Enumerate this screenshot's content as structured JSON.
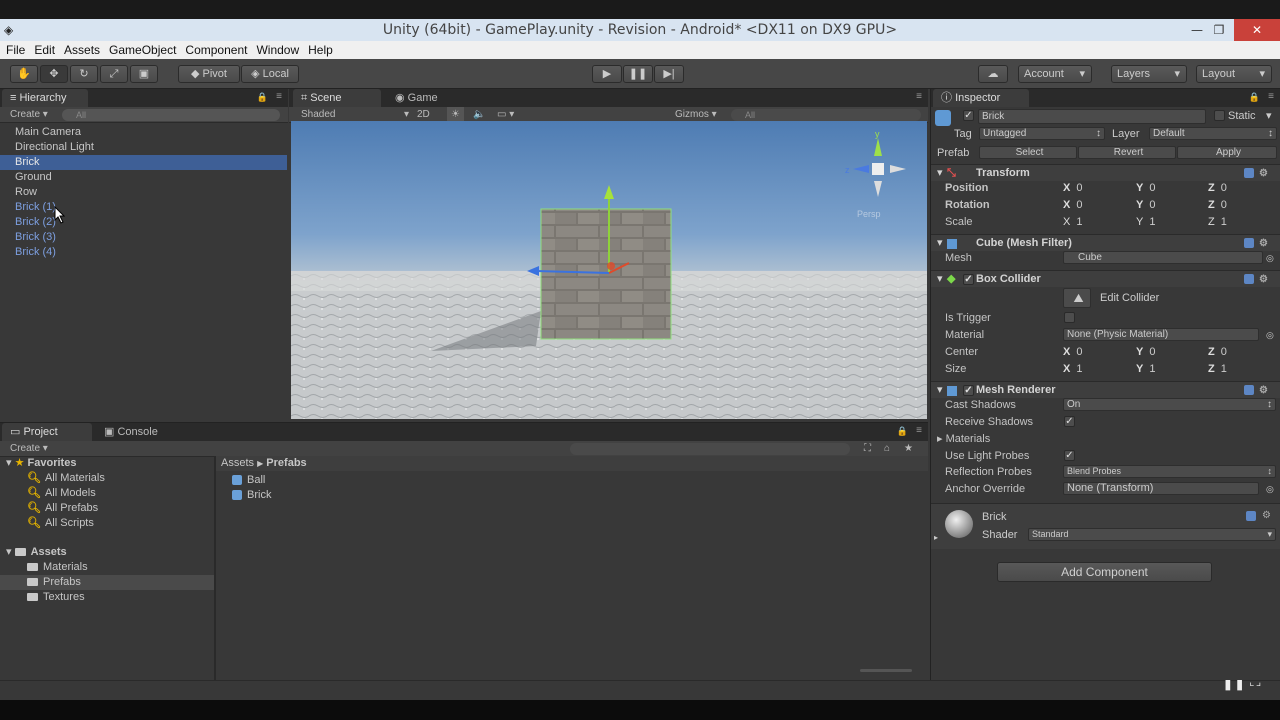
{
  "window": {
    "title": "Unity (64bit) - GamePlay.unity - Revision - Android* <DX11 on DX9 GPU>"
  },
  "menu": [
    "File",
    "Edit",
    "Assets",
    "GameObject",
    "Component",
    "Window",
    "Help"
  ],
  "toolbar": {
    "pivot": "Pivot",
    "local": "Local",
    "account": "Account",
    "layers": "Layers",
    "layout": "Layout"
  },
  "hierarchy": {
    "tab": "Hierarchy",
    "create": "Create",
    "search_placeholder": "All",
    "items": [
      "Main Camera",
      "Directional Light",
      "Brick",
      "Ground",
      "Row",
      "Brick (1)",
      "Brick (2)",
      "Brick (3)",
      "Brick (4)"
    ]
  },
  "scene": {
    "tab_scene": "Scene",
    "tab_game": "Game",
    "shaded": "Shaded",
    "mode_2d": "2D",
    "gizmos": "Gizmos",
    "search_placeholder": "All",
    "persp": "Persp"
  },
  "project": {
    "tab_project": "Project",
    "tab_console": "Console",
    "create": "Create",
    "favorites_label": "Favorites",
    "favorites": [
      "All Materials",
      "All Models",
      "All Prefabs",
      "All Scripts"
    ],
    "assets_label": "Assets",
    "folders": [
      "Materials",
      "Prefabs",
      "Textures"
    ],
    "breadcrumb_root": "Assets",
    "breadcrumb_current": "Prefabs",
    "files": [
      "Ball",
      "Brick"
    ]
  },
  "inspector": {
    "tab": "Inspector",
    "object_name": "Brick",
    "static": "Static",
    "tag_label": "Tag",
    "tag_value": "Untagged",
    "layer_label": "Layer",
    "layer_value": "Default",
    "prefab_label": "Prefab",
    "prefab_select": "Select",
    "prefab_revert": "Revert",
    "prefab_apply": "Apply",
    "transform": {
      "title": "Transform",
      "position_label": "Position",
      "position": [
        "0",
        "0",
        "0"
      ],
      "rotation_label": "Rotation",
      "rotation": [
        "0",
        "0",
        "0"
      ],
      "scale_label": "Scale",
      "scale": [
        "1",
        "1",
        "1"
      ]
    },
    "mesh_filter": {
      "title": "Cube (Mesh Filter)",
      "mesh_label": "Mesh",
      "mesh_value": "Cube"
    },
    "box_collider": {
      "title": "Box Collider",
      "edit_collider": "Edit Collider",
      "is_trigger_label": "Is Trigger",
      "material_label": "Material",
      "material_value": "None (Physic Material)",
      "center_label": "Center",
      "center": [
        "0",
        "0",
        "0"
      ],
      "size_label": "Size",
      "size": [
        "1",
        "1",
        "1"
      ]
    },
    "mesh_renderer": {
      "title": "Mesh Renderer",
      "cast_shadows_label": "Cast Shadows",
      "cast_shadows_value": "On",
      "receive_shadows_label": "Receive Shadows",
      "materials_label": "Materials",
      "use_light_probes_label": "Use Light Probes",
      "reflection_probes_label": "Reflection Probes",
      "reflection_probes_value": "Blend Probes",
      "anchor_override_label": "Anchor Override",
      "anchor_override_value": "None (Transform)"
    },
    "material": {
      "name": "Brick",
      "shader_label": "Shader",
      "shader_value": "Standard"
    },
    "add_component": "Add Component"
  },
  "axis_letters": [
    "X",
    "Y",
    "Z"
  ]
}
